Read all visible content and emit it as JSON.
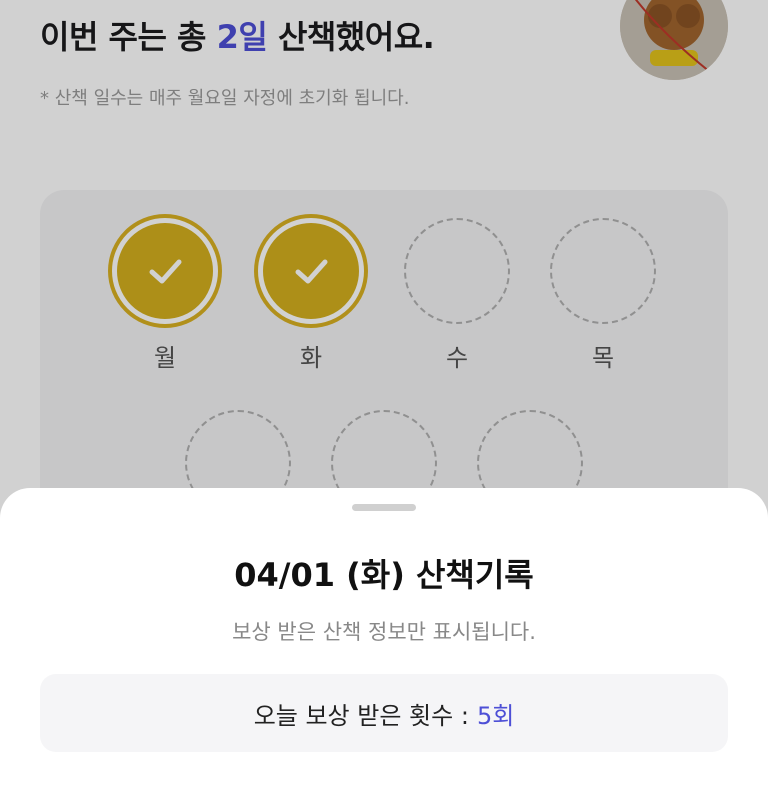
{
  "header": {
    "headline_prefix": "이번 주는 총",
    "headline_days": "2일",
    "headline_suffix": "산책했어요.",
    "note": "* 산책 일수는 매주 월요일 자정에 초기화 됩니다."
  },
  "avatar": {
    "icon": "dog-photo-avatar"
  },
  "week": {
    "days": [
      {
        "label": "월",
        "walked": true
      },
      {
        "label": "화",
        "walked": true
      },
      {
        "label": "수",
        "walked": false
      },
      {
        "label": "목",
        "walked": false
      },
      {
        "label": "",
        "walked": false
      },
      {
        "label": "",
        "walked": false
      },
      {
        "label": "",
        "walked": false
      }
    ]
  },
  "sheet": {
    "title": "04/01 (화) 산책기록",
    "subtitle": "보상 받은 산책 정보만 표시됩니다.",
    "reward_label": "오늘 보상 받은 횟수 :",
    "reward_count": "5회"
  },
  "colors": {
    "accent": "#4d4fd6",
    "walked": "#d4af1e"
  }
}
